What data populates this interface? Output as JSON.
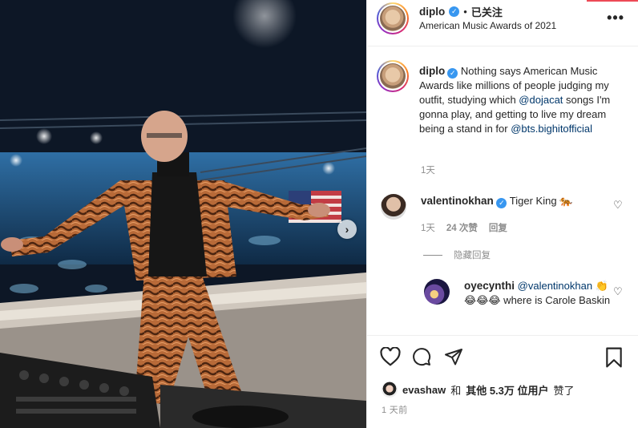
{
  "header": {
    "username": "diplo",
    "dot": "•",
    "follow_state": "已关注",
    "location": "American Music Awards of 2021",
    "more": "•••"
  },
  "caption": {
    "username": "diplo",
    "text_part1": "Nothing says American Music Awards like millions of people judging my outfit, studying which ",
    "mention1": "@dojacat",
    "text_part2": " songs I'm gonna play, and getting to live my dream being a stand in for ",
    "mention2": "@bts.bighitofficial",
    "time": "1天"
  },
  "comments": [
    {
      "username": "valentinokhan",
      "text": "Tiger King 🐅",
      "time": "1天",
      "likes": "24 次赞",
      "reply": "回复"
    }
  ],
  "hide_replies": "隐藏回复",
  "reply": {
    "username": "oyecynthi",
    "mention": "@valentinokhan",
    "text": "👏😂😂😂 where is Carole Baskin"
  },
  "likes": {
    "first_user": "evashaw",
    "and": "和",
    "others": "其他 5.3万 位用户",
    "suffix": "赞了"
  },
  "time_ago": "1 天前",
  "icons": {
    "verified": "verified-badge",
    "like": "heart-icon",
    "comment": "comment-icon",
    "share": "paper-plane-icon",
    "save": "bookmark-icon",
    "next": "chevron-right-icon"
  },
  "colors": {
    "link": "#00376b",
    "verified": "#3897f0",
    "muted": "#8e8e8e",
    "accent": "#ed4956"
  }
}
